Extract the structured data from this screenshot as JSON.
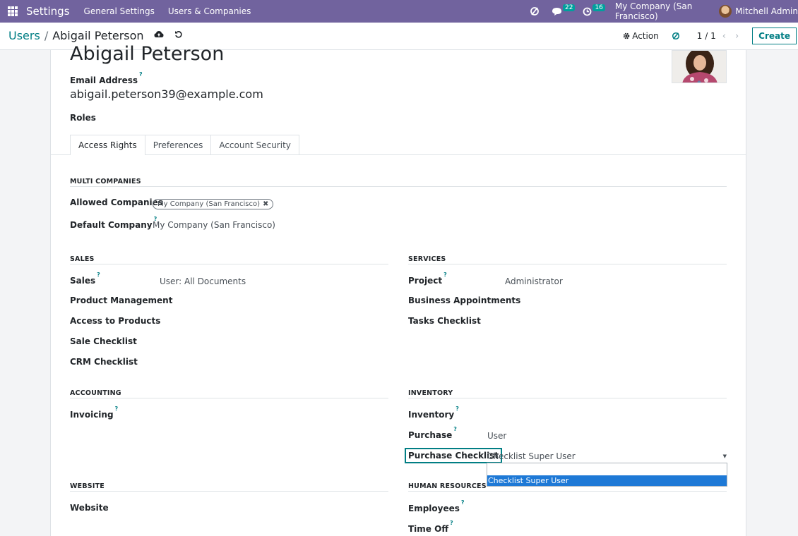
{
  "navbar": {
    "app_name": "Settings",
    "menus": [
      "General Settings",
      "Users & Companies"
    ],
    "messages_badge": "22",
    "activities_badge": "16",
    "company": "My Company (San Francisco)",
    "user": "Mitchell Admin"
  },
  "breadcrumb": {
    "parent": "Users",
    "separator": "/",
    "current": "Abigail Peterson"
  },
  "control": {
    "action_label": "Action",
    "pager": "1 / 1",
    "create_label": "Create"
  },
  "form": {
    "name": "Abigail Peterson",
    "email_label": "Email Address",
    "email_value": "abigail.peterson39@example.com",
    "roles_label": "Roles",
    "help_mark": "?",
    "tabs": [
      "Access Rights",
      "Preferences",
      "Account Security"
    ]
  },
  "multi_companies": {
    "title": "MULTI COMPANIES",
    "allowed_label": "Allowed Companies",
    "allowed_tag": "My Company (San Francisco)",
    "default_label": "Default Company",
    "default_value": "My Company (San Francisco)"
  },
  "sales": {
    "title": "SALES",
    "sales_label": "Sales",
    "sales_value": "User: All Documents",
    "product_management": "Product Management",
    "access_to_products": "Access to Products",
    "sale_checklist": "Sale Checklist",
    "crm_checklist": "CRM Checklist"
  },
  "services": {
    "title": "SERVICES",
    "project_label": "Project",
    "project_value": "Administrator",
    "business_appointments": "Business Appointments",
    "tasks_checklist": "Tasks Checklist"
  },
  "accounting": {
    "title": "ACCOUNTING",
    "invoicing_label": "Invoicing"
  },
  "inventory": {
    "title": "INVENTORY",
    "inventory_label": "Inventory",
    "purchase_label": "Purchase",
    "purchase_value": "User",
    "purchase_checklist_label": "Purchase Checklist",
    "purchase_checklist_value": "Checklist Super User",
    "dropdown_option": "Checklist Super User"
  },
  "website": {
    "title": "WEBSITE",
    "website_label": "Website"
  },
  "human_resources": {
    "title": "HUMAN RESOURCES",
    "employees_label": "Employees",
    "time_off_label": "Time Off"
  },
  "colors": {
    "navbar": "#71639e",
    "accent": "#017e84",
    "selection": "#1e79d6",
    "badge": "#00a09d"
  }
}
